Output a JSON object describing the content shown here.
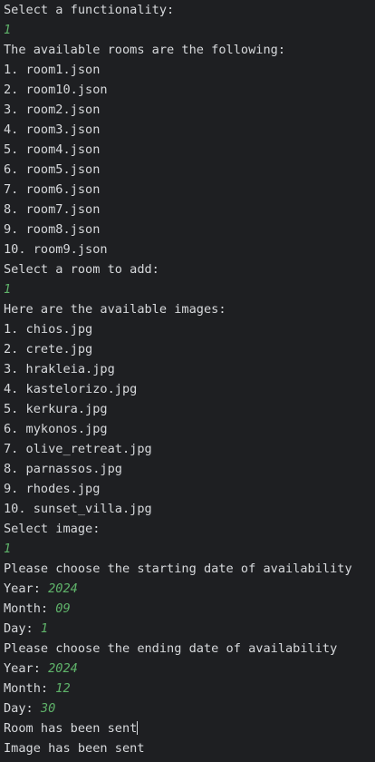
{
  "theme": {
    "background": "#1e1f22",
    "text": "#d7d9dc",
    "input": "#5fb36a"
  },
  "lines": [
    {
      "text": "Select a functionality:"
    },
    {
      "input": "1"
    },
    {
      "text": "The available rooms are the following:"
    },
    {
      "text": "1. room1.json"
    },
    {
      "text": "2. room10.json"
    },
    {
      "text": "3. room2.json"
    },
    {
      "text": "4. room3.json"
    },
    {
      "text": "5. room4.json"
    },
    {
      "text": "6. room5.json"
    },
    {
      "text": "7. room6.json"
    },
    {
      "text": "8. room7.json"
    },
    {
      "text": "9. room8.json"
    },
    {
      "text": "10. room9.json"
    },
    {
      "text": "Select a room to add:"
    },
    {
      "input": "1"
    },
    {
      "text": "Here are the available images:"
    },
    {
      "text": "1. chios.jpg"
    },
    {
      "text": "2. crete.jpg"
    },
    {
      "text": "3. hrakleia.jpg"
    },
    {
      "text": "4. kastelorizo.jpg"
    },
    {
      "text": "5. kerkura.jpg"
    },
    {
      "text": "6. mykonos.jpg"
    },
    {
      "text": "7. olive_retreat.jpg"
    },
    {
      "text": "8. parnassos.jpg"
    },
    {
      "text": "9. rhodes.jpg"
    },
    {
      "text": "10. sunset_villa.jpg"
    },
    {
      "text": "Select image:"
    },
    {
      "input": "1"
    },
    {
      "text": "Please choose the starting date of availability"
    },
    {
      "text": "Year: ",
      "input": "2024"
    },
    {
      "text": "Month: ",
      "input": "09"
    },
    {
      "text": "Day: ",
      "input": "1"
    },
    {
      "text": "Please choose the ending date of availability"
    },
    {
      "text": "Year: ",
      "input": "2024"
    },
    {
      "text": "Month: ",
      "input": "12"
    },
    {
      "text": "Day: ",
      "input": "30"
    },
    {
      "text": "Room has been sent",
      "cursor": true
    },
    {
      "text": "Image has been sent"
    }
  ]
}
